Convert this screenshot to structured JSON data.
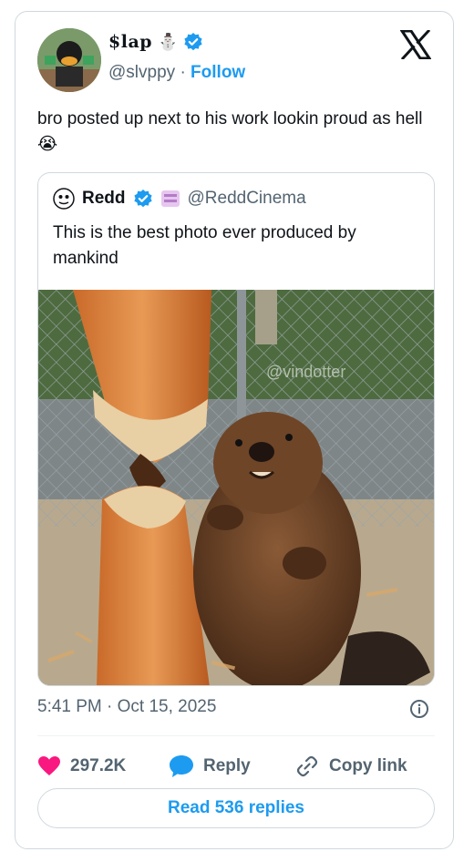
{
  "author": {
    "display_name": "$lap",
    "name_emoji": "⛄",
    "handle": "@slvppy",
    "separator": "·",
    "follow_label": "Follow",
    "verified": true
  },
  "tweet": {
    "text": "bro posted up next to his work lookin proud as hell 😭"
  },
  "quoted_tweet": {
    "display_name": "Redd",
    "handle": "@ReddCinema",
    "verified": true,
    "text": "This is the best photo ever produced by mankind",
    "image_alt": "beaver standing next to gnawed tree stump",
    "watermark": "@vindotter"
  },
  "meta": {
    "timestamp": "5:41 PM · Oct 15, 2025"
  },
  "actions": {
    "like_count": "297.2K",
    "reply_label": "Reply",
    "copy_label": "Copy link"
  },
  "read_replies_label": "Read 536 replies",
  "colors": {
    "accent": "#1d9bf0",
    "like": "#f91880",
    "muted": "#536471",
    "border": "#cfd9de"
  },
  "icons": [
    "x-logo-icon",
    "verified-badge-icon",
    "heart-icon",
    "reply-bubble-icon",
    "link-icon",
    "info-icon"
  ]
}
